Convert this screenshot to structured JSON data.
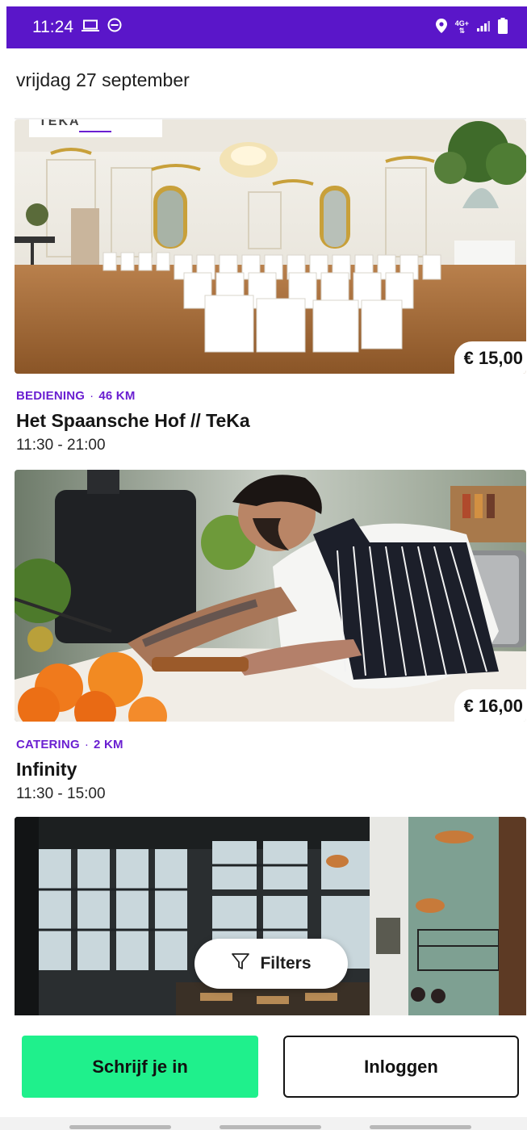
{
  "status_bar": {
    "time": "11:24",
    "network": "4G+",
    "colors": {
      "background": "#5a16c9"
    }
  },
  "date_header": "vrijdag 27 september",
  "listings": [
    {
      "category": "BEDIENING",
      "separator": "·",
      "distance": "46 KM",
      "price": "€ 15,00",
      "title": "Het Spaansche Hof // TeKa",
      "hours": "11:30 - 21:00",
      "logo_text": "TEKA"
    },
    {
      "category": "CATERING",
      "separator": "·",
      "distance": "2 KM",
      "price": "€ 16,00",
      "title": "Infinity",
      "hours": "11:30 - 15:00"
    },
    {
      "category": "",
      "distance": "",
      "price": "",
      "title": "",
      "hours": ""
    }
  ],
  "filters_button": {
    "label": "Filters",
    "icon": "filter-icon"
  },
  "actions": {
    "signup_label": "Schrijf je in",
    "login_label": "Inloggen"
  },
  "colors": {
    "accent_purple": "#6a1fd1",
    "signup_green": "#1ff08c"
  }
}
